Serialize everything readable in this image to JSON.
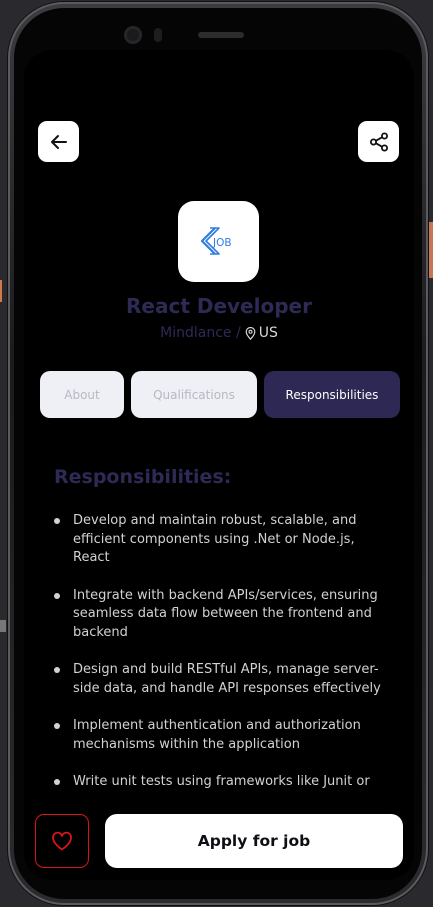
{
  "header": {
    "back_icon": "arrow-left-icon",
    "share_icon": "share-icon"
  },
  "job": {
    "logo_text": "JOB",
    "title": "React Developer",
    "company": "Mindlance /",
    "location": "US"
  },
  "tabs": [
    {
      "label": "About",
      "active": false
    },
    {
      "label": "Qualifications",
      "active": false
    },
    {
      "label": "Responsibilities",
      "active": true
    }
  ],
  "responsibilities": {
    "heading": "Responsibilities:",
    "items": [
      "Develop and maintain robust, scalable, and efficient components using .Net or Node.js, React",
      "Integrate with backend APIs/services, ensuring seamless data flow between the frontend and backend",
      "Design and build RESTful APIs, manage server-side data, and handle API responses effectively",
      "Implement authentication and authorization mechanisms within the application",
      "Write unit tests using frameworks like Junit or"
    ]
  },
  "footer": {
    "favorite_icon": "heart-icon",
    "apply_label": "Apply for job"
  },
  "colors": {
    "accent": "#2d2854",
    "favorite": "#d81616",
    "background": "#000000"
  }
}
